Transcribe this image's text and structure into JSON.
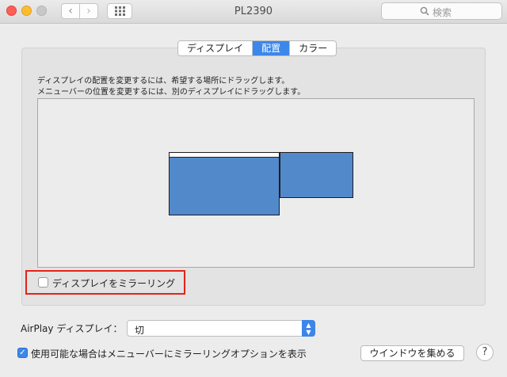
{
  "window": {
    "title": "PL2390"
  },
  "toolbar": {
    "back_glyph": "‹",
    "forward_glyph": "›",
    "search_placeholder": "検索"
  },
  "tabs": [
    {
      "label": "ディスプレイ",
      "active": false
    },
    {
      "label": "配置",
      "active": true
    },
    {
      "label": "カラー",
      "active": false
    }
  ],
  "arrangement": {
    "instruction_1": "ディスプレイの配置を変更するには、希望する場所にドラッグします。",
    "instruction_2": "メニューバーの位置を変更するには、別のディスプレイにドラッグします。",
    "mirror_label": "ディスプレイをミラーリング",
    "mirror_checked": false
  },
  "airplay": {
    "label": "AirPlay ディスプレイ：",
    "selected": "切"
  },
  "menubar_option": {
    "label": "使用可能な場合はメニューバーにミラーリングオプションを表示",
    "checked": true,
    "check_glyph": "✓"
  },
  "buttons": {
    "gather_windows": "ウインドウを集める",
    "help": "?"
  },
  "colors": {
    "accent": "#3c87ea",
    "display_fill": "#5289cb",
    "highlight_border": "#e3231b"
  }
}
